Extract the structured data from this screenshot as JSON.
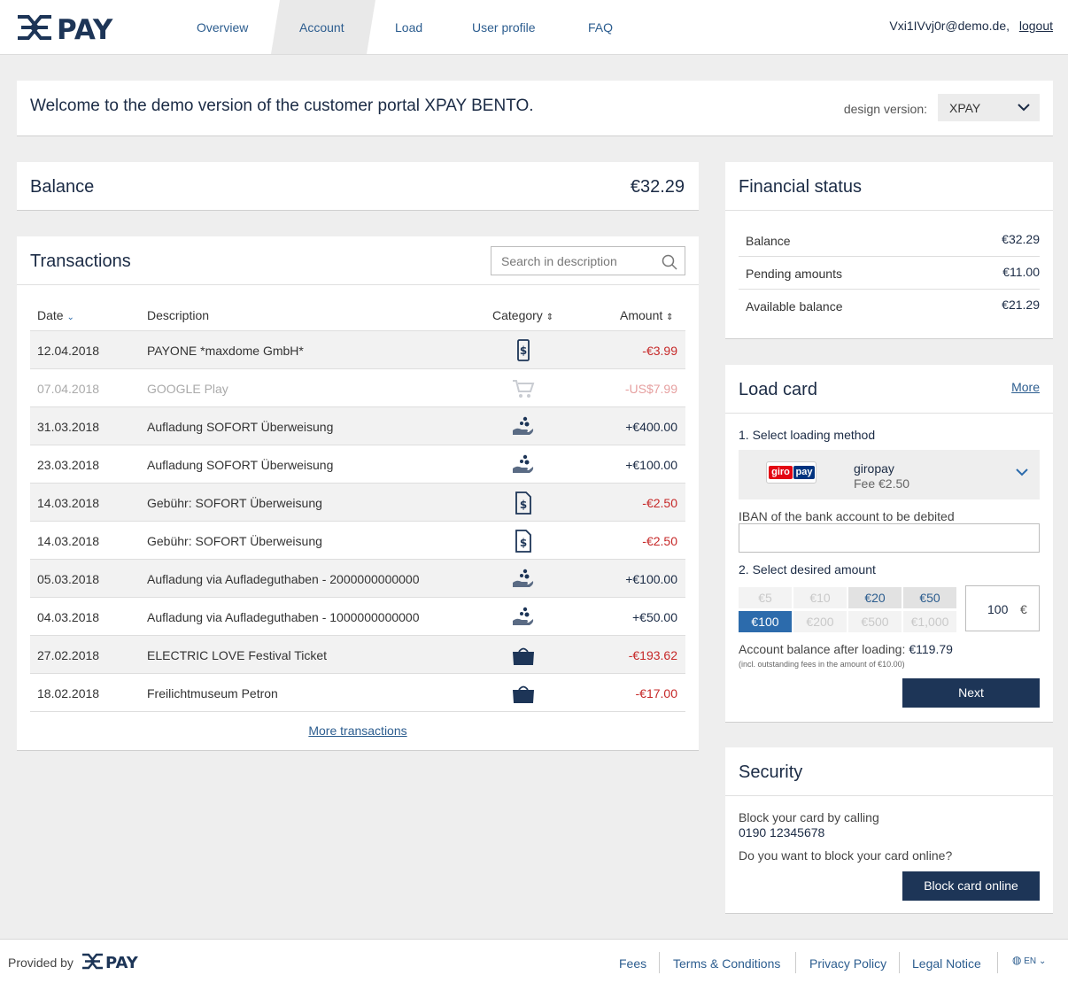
{
  "header": {
    "logo_text": "XPAY",
    "nav": [
      "Overview",
      "Account",
      "Load",
      "User profile",
      "FAQ"
    ],
    "active_tab": "Account",
    "user_email": "Vxi1IVvj0r@demo.de,",
    "logout": "logout"
  },
  "welcome": {
    "title": "Welcome to the demo version of the customer portal XPAY BENTO.",
    "design_label": "design version:",
    "design_value": "XPAY"
  },
  "balance": {
    "title": "Balance",
    "amount": "€32.29"
  },
  "transactions": {
    "title": "Transactions",
    "search_placeholder": "Search in description",
    "columns": {
      "date": "Date",
      "description": "Description",
      "category": "Category",
      "amount": "Amount"
    },
    "rows": [
      {
        "date": "12.04.2018",
        "description": "PAYONE *maxdome GmbH*",
        "category": "phone-icon",
        "amount": "-€3.99"
      },
      {
        "date": "07.04.2018",
        "description": "GOOGLE Play",
        "category": "cart-icon",
        "amount": "-US$7.99"
      },
      {
        "date": "31.03.2018",
        "description": "Aufladung SOFORT Überweisung",
        "category": "load-hand-icon",
        "amount": "+€400.00"
      },
      {
        "date": "23.03.2018",
        "description": "Aufladung SOFORT Überweisung",
        "category": "load-hand-icon",
        "amount": "+€100.00"
      },
      {
        "date": "14.03.2018",
        "description": "Gebühr: SOFORT Überweisung",
        "category": "fee-document-icon",
        "amount": "-€2.50"
      },
      {
        "date": "14.03.2018",
        "description": "Gebühr: SOFORT Überweisung",
        "category": "fee-document-icon",
        "amount": "-€2.50"
      },
      {
        "date": "05.03.2018",
        "description": "Aufladung via Aufladeguthaben - 2000000000000",
        "category": "load-hand-icon",
        "amount": "+€100.00"
      },
      {
        "date": "04.03.2018",
        "description": "Aufladung via Aufladeguthaben - 1000000000000",
        "category": "load-hand-icon",
        "amount": "+€50.00"
      },
      {
        "date": "27.02.2018",
        "description": "ELECTRIC LOVE Festival Ticket",
        "category": "shopping-bag-icon",
        "amount": "-€193.62"
      },
      {
        "date": "18.02.2018",
        "description": "Freilichtmuseum Petron",
        "category": "shopping-bag-icon",
        "amount": "-€17.00"
      }
    ],
    "more": "More transactions"
  },
  "financial": {
    "title": "Financial status",
    "rows": [
      {
        "label": "Balance",
        "value": "€32.29"
      },
      {
        "label": "Pending amounts",
        "value": "€11.00"
      },
      {
        "label": "Available balance",
        "value": "€21.29"
      }
    ]
  },
  "load": {
    "title": "Load card",
    "more": "More",
    "step1": "1. Select loading method",
    "method_logo_left": "giro",
    "method_logo_right": "pay",
    "method_name": "giropay",
    "method_fee": "Fee €2.50",
    "iban_label": "IBAN of the bank account to be debited",
    "step2": "2. Select desired amount",
    "amounts": [
      "€5",
      "€10",
      "€20",
      "€50",
      "€100",
      "€200",
      "€500",
      "€1,000"
    ],
    "selected_amount": "€100",
    "amount_value": "100",
    "amount_currency": "€",
    "after_label": "Account balance after loading:",
    "after_value": "€119.79",
    "after_note": "(incl. outstanding fees in the amount of €10.00)",
    "next": "Next"
  },
  "security": {
    "title": "Security",
    "text1": "Block your card by calling",
    "phone": "0190 12345678",
    "text2": "Do you want to block your card online?",
    "button": "Block card online"
  },
  "footer": {
    "provided": "Provided by",
    "links": [
      "Fees",
      "Terms & Conditions",
      "Privacy Policy",
      "Legal Notice"
    ],
    "lang": "EN"
  },
  "colors": {
    "primary": "#1d3557",
    "link": "#2c5d8f",
    "negative": "#c62828",
    "selected": "#2c6bac"
  }
}
